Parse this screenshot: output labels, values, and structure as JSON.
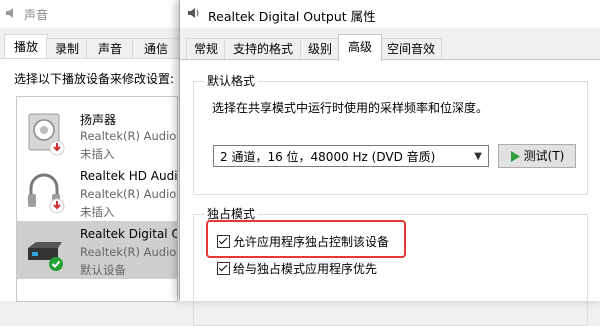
{
  "background_window": {
    "title": "声音",
    "tabs": [
      {
        "label": "播放",
        "active": true
      },
      {
        "label": "录制"
      },
      {
        "label": "声音"
      },
      {
        "label": "通信"
      }
    ],
    "instruction": "选择以下播放设备来修改设置:",
    "devices": [
      {
        "name": "扬声器",
        "driver": "Realtek(R) Audio",
        "status": "未插入",
        "icon": "speaker-icon",
        "badge": "unplugged-arrow-icon"
      },
      {
        "name": "Realtek HD Audio",
        "driver": "Realtek(R) Audio",
        "status": "未插入",
        "icon": "headphones-icon",
        "badge": "unplugged-arrow-icon"
      },
      {
        "name": "Realtek Digital Output",
        "driver": "Realtek(R) Audio",
        "status": "默认设备",
        "icon": "digital-output-icon",
        "badge": "default-check-icon",
        "selected": true
      }
    ]
  },
  "dialog": {
    "title": "Realtek Digital Output 属性",
    "tabs": [
      {
        "label": "常规"
      },
      {
        "label": "支持的格式"
      },
      {
        "label": "级别"
      },
      {
        "label": "高级",
        "active": true
      },
      {
        "label": "空间音效"
      }
    ],
    "default_format": {
      "group_label": "默认格式",
      "description": "选择在共享模式中运行时使用的采样频率和位深度。",
      "selected_format": "2 通道，16 位，48000 Hz (DVD 音质)",
      "test_button": "测试(T)"
    },
    "exclusive_mode": {
      "group_label": "独占模式",
      "allow_exclusive": {
        "label": "允许应用程序独占控制该设备",
        "checked": true
      },
      "give_priority": {
        "label": "给与独占模式应用程序优先",
        "checked": true
      }
    },
    "colors": {
      "highlight": "#e53935",
      "test_play_icon": "#2e9e3e",
      "default_badge": "#22a030",
      "unplugged_arrow": "#d32f2f"
    }
  }
}
